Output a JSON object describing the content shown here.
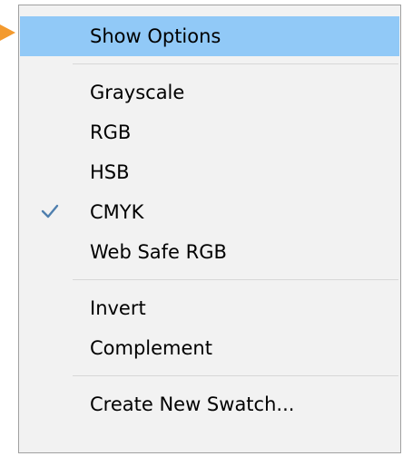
{
  "menu": {
    "items": [
      {
        "label": "Show Options"
      },
      {
        "label": "Grayscale"
      },
      {
        "label": "RGB"
      },
      {
        "label": "HSB"
      },
      {
        "label": "CMYK",
        "checked": true
      },
      {
        "label": "Web Safe RGB"
      },
      {
        "label": "Invert"
      },
      {
        "label": "Complement"
      },
      {
        "label": "Create New Swatch..."
      }
    ]
  },
  "icons": {
    "pointer": "arrow-right-icon",
    "check": "checkmark-icon"
  },
  "colors": {
    "pointer": "#f39a2e",
    "highlight": "#91c9f7",
    "checked_background": "#cce4f7",
    "menu_background": "#f2f2f2",
    "check_color": "#4f7fae"
  }
}
